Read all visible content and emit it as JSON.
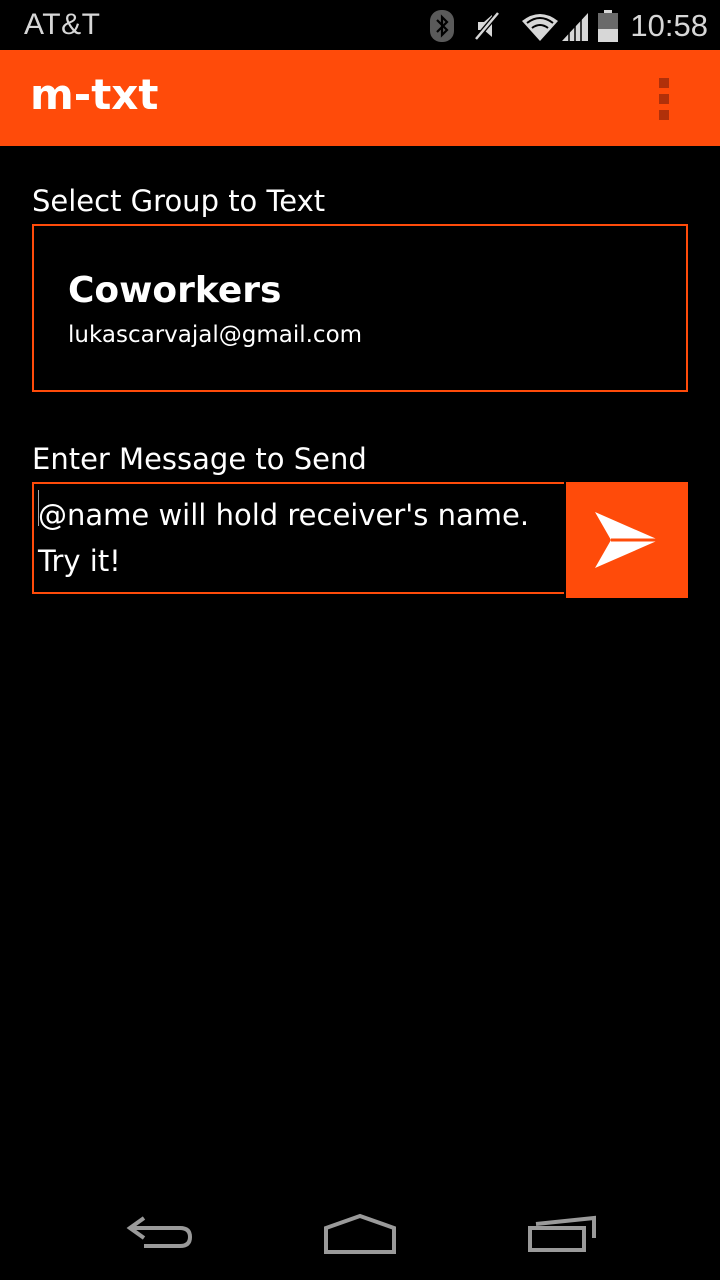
{
  "status_bar": {
    "carrier": "AT&T",
    "time": "10:58",
    "icons": [
      "bluetooth-icon",
      "vibrate-off-icon",
      "wifi-icon",
      "signal-icon",
      "battery-icon"
    ]
  },
  "app_bar": {
    "title": "m-txt",
    "menu_icon": "overflow-menu-icon"
  },
  "group_section": {
    "label": "Select Group to Text",
    "selected_group": {
      "name": "Coworkers",
      "email": "lukascarvajal@gmail.com"
    }
  },
  "message_section": {
    "label": "Enter Message to Send",
    "placeholder": "@name will hold receiver's name.\nTry it!",
    "send_icon": "send-icon"
  },
  "colors": {
    "accent": "#ff4b0a",
    "background": "#000000",
    "text": "#ffffff"
  },
  "nav_bar": {
    "icons": [
      "back-icon",
      "home-icon",
      "recents-icon"
    ]
  }
}
